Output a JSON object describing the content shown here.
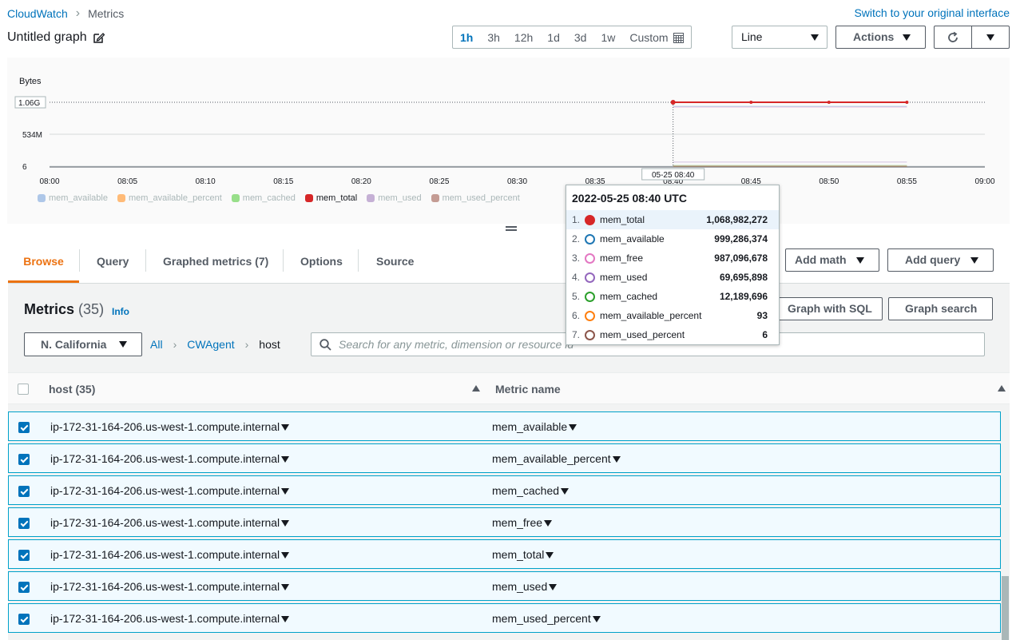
{
  "header": {
    "breadcrumb": [
      "CloudWatch",
      "Metrics"
    ],
    "switch_link": "Switch to your original interface",
    "graph_title": "Untitled graph",
    "time_ranges": [
      "1h",
      "3h",
      "12h",
      "1d",
      "3d",
      "1w",
      "Custom"
    ],
    "active_range": "1h",
    "chart_type": "Line",
    "actions_label": "Actions"
  },
  "chart_data": {
    "type": "line",
    "ylabel": "Bytes",
    "y_ticks": [
      "1.06G",
      "534M",
      "6"
    ],
    "x_ticks": [
      "08:00",
      "08:05",
      "08:10",
      "08:15",
      "08:20",
      "08:25",
      "08:30",
      "08:35",
      "08:40",
      "08:45",
      "08:50",
      "08:55",
      "09:00"
    ],
    "cursor_label": "05-25 08:40",
    "x": [
      "08:40",
      "08:45",
      "08:50",
      "08:55"
    ],
    "series": [
      {
        "name": "mem_total",
        "values": [
          1068982272,
          1068982272,
          1068982272,
          1068982272
        ],
        "color": "#d62728",
        "active": true
      },
      {
        "name": "mem_available",
        "values": [
          999286374,
          999286374,
          999286374,
          999286374
        ],
        "color": "#1f77b4",
        "active": false
      },
      {
        "name": "mem_free",
        "values": [
          987096678,
          987096678,
          987096678,
          987096678
        ],
        "color": "#e377c2",
        "active": false
      },
      {
        "name": "mem_used",
        "values": [
          69695898,
          69695898,
          69695898,
          69695898
        ],
        "color": "#9467bd",
        "active": false
      },
      {
        "name": "mem_cached",
        "values": [
          12189696,
          12189696,
          12189696,
          12189696
        ],
        "color": "#2ca02c",
        "active": false
      },
      {
        "name": "mem_available_percent",
        "values": [
          93,
          93,
          93,
          93
        ],
        "color": "#ff7f0e",
        "active": false
      },
      {
        "name": "mem_used_percent",
        "values": [
          6,
          6,
          6,
          6
        ],
        "color": "#8c564b",
        "active": false
      }
    ],
    "legend": [
      {
        "name": "mem_available",
        "color": "#aec7e8",
        "on": false
      },
      {
        "name": "mem_available_percent",
        "color": "#ffbb78",
        "on": false
      },
      {
        "name": "mem_cached",
        "color": "#98df8a",
        "on": false
      },
      {
        "name": "mem_total",
        "color": "#d62728",
        "on": true
      },
      {
        "name": "mem_used",
        "color": "#c5b0d5",
        "on": false
      },
      {
        "name": "mem_used_percent",
        "color": "#c49c94",
        "on": false
      }
    ]
  },
  "tooltip": {
    "title": "2022-05-25 08:40 UTC",
    "rows": [
      {
        "idx": "1.",
        "name": "mem_total",
        "value": "1,068,982,272",
        "color": "#d62728",
        "filled": true
      },
      {
        "idx": "2.",
        "name": "mem_available",
        "value": "999,286,374",
        "color": "#1f77b4",
        "filled": false
      },
      {
        "idx": "3.",
        "name": "mem_free",
        "value": "987,096,678",
        "color": "#e377c2",
        "filled": false
      },
      {
        "idx": "4.",
        "name": "mem_used",
        "value": "69,695,898",
        "color": "#9467bd",
        "filled": false
      },
      {
        "idx": "5.",
        "name": "mem_cached",
        "value": "12,189,696",
        "color": "#2ca02c",
        "filled": false
      },
      {
        "idx": "6.",
        "name": "mem_available_percent",
        "value": "93",
        "color": "#ff7f0e",
        "filled": false
      },
      {
        "idx": "7.",
        "name": "mem_used_percent",
        "value": "6",
        "color": "#8c564b",
        "filled": false
      }
    ]
  },
  "tabs": [
    "Browse",
    "Query",
    "Graphed metrics (7)",
    "Options",
    "Source"
  ],
  "add_math": "Add math",
  "add_query": "Add query",
  "metrics": {
    "title": "Metrics",
    "count": "(35)",
    "info": "Info",
    "graph_sql": "Graph with SQL",
    "graph_search": "Graph search",
    "region": "N. California",
    "path": [
      "All",
      "CWAgent",
      "host"
    ],
    "search_placeholder": "Search for any metric, dimension or resource id",
    "col_host": "host",
    "col_host_count": "(35)",
    "col_metric": "Metric name",
    "rows": [
      {
        "host": "ip-172-31-164-206.us-west-1.compute.internal",
        "metric": "mem_available"
      },
      {
        "host": "ip-172-31-164-206.us-west-1.compute.internal",
        "metric": "mem_available_percent"
      },
      {
        "host": "ip-172-31-164-206.us-west-1.compute.internal",
        "metric": "mem_cached"
      },
      {
        "host": "ip-172-31-164-206.us-west-1.compute.internal",
        "metric": "mem_free"
      },
      {
        "host": "ip-172-31-164-206.us-west-1.compute.internal",
        "metric": "mem_total"
      },
      {
        "host": "ip-172-31-164-206.us-west-1.compute.internal",
        "metric": "mem_used"
      },
      {
        "host": "ip-172-31-164-206.us-west-1.compute.internal",
        "metric": "mem_used_percent"
      }
    ]
  }
}
